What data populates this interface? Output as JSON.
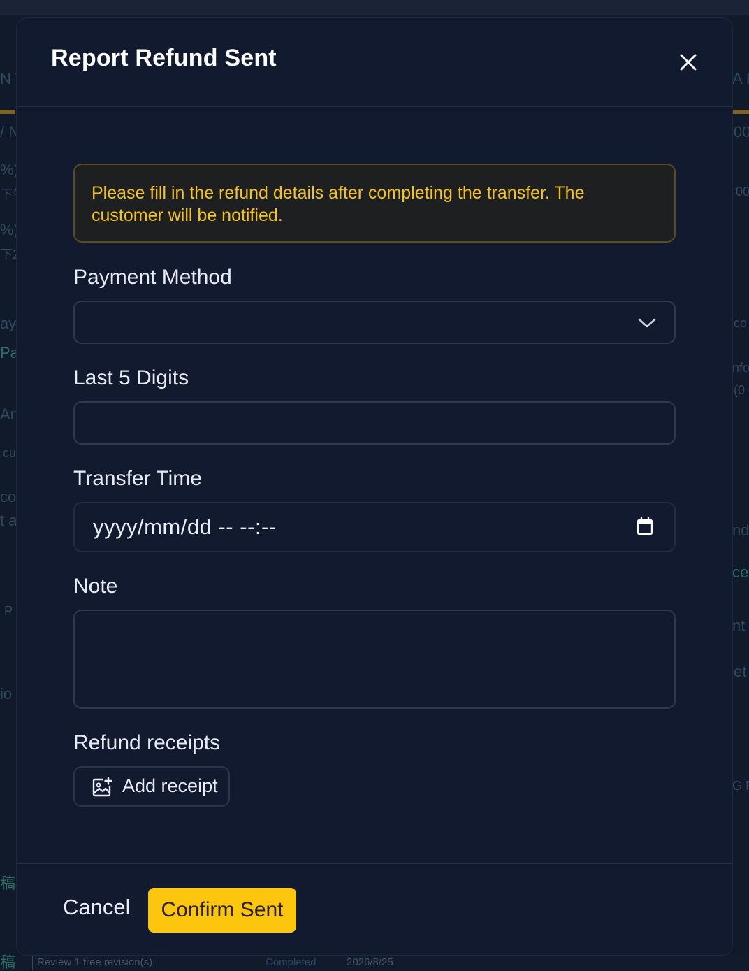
{
  "modal": {
    "title": "Report Refund Sent",
    "notice": "Please fill in the refund details after completing the transfer. The customer will be notified.",
    "payment_method": {
      "label": "Payment Method",
      "selected": ""
    },
    "last_digits": {
      "label": "Last 5 Digits",
      "value": ""
    },
    "transfer_time": {
      "label": "Transfer Time",
      "placeholder": "yyyy/mm/dd -- --:--"
    },
    "note": {
      "label": "Note",
      "value": ""
    },
    "receipts": {
      "label": "Refund receipts",
      "add_label": "Add receipt"
    },
    "footer": {
      "cancel_label": "Cancel",
      "confirm_label": "Confirm Sent"
    }
  },
  "background": {
    "left_fragments": [
      "N T",
      "/ N",
      "%)",
      "下午",
      "%)",
      "下2",
      "ay",
      "Pa",
      "An",
      "cu",
      "co",
      "t a",
      "P",
      "io",
      "稿"
    ],
    "right_fragments": [
      "A I",
      "00",
      ":00",
      "co",
      "nfo",
      "(0",
      "nd",
      "ce",
      "nt",
      "et",
      "G F"
    ],
    "footer": {
      "status_left": "稿",
      "review": "Review",
      "revision": "1 free revision(s)",
      "completed": "Completed",
      "date": "2026/8/25"
    }
  },
  "colors": {
    "modal_background": "#111a2e",
    "accent": "#fcc60f",
    "notice_text": "#f4c21c",
    "notice_border": "#5a4e1c"
  },
  "icons": {
    "close": "close-icon",
    "dropdown": "chevron-down-icon",
    "calendar": "calendar-icon",
    "add_image": "image-add-icon"
  }
}
